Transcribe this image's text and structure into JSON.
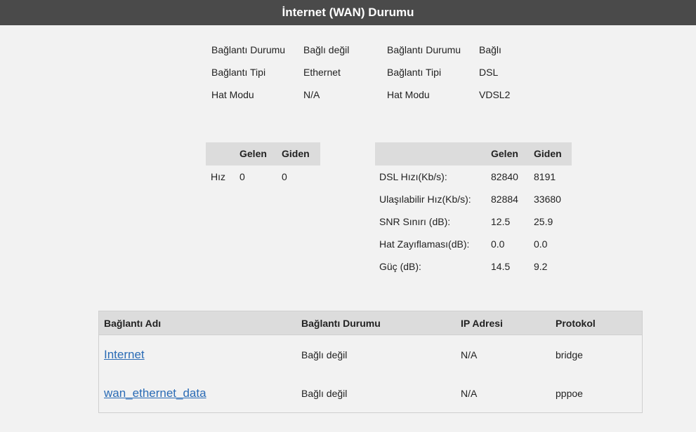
{
  "header": {
    "title": "İnternet (WAN) Durumu"
  },
  "status_left": {
    "rows": [
      {
        "label": "Bağlantı Durumu",
        "value": "Bağlı değil"
      },
      {
        "label": "Bağlantı Tipi",
        "value": "Ethernet"
      },
      {
        "label": "Hat Modu",
        "value": "N/A"
      }
    ]
  },
  "status_right": {
    "rows": [
      {
        "label": "Bağlantı Durumu",
        "value": "Bağlı"
      },
      {
        "label": "Bağlantı Tipi",
        "value": "DSL"
      },
      {
        "label": "Hat Modu",
        "value": "VDSL2"
      }
    ]
  },
  "speed_table": {
    "headers": [
      "Gelen",
      "Giden"
    ],
    "row": {
      "label": "Hız",
      "in": "0",
      "out": "0"
    }
  },
  "dsl_table": {
    "headers": [
      "Gelen",
      "Giden"
    ],
    "rows": [
      {
        "label": "DSL Hızı(Kb/s):",
        "in": "82840",
        "out": "8191"
      },
      {
        "label": "Ulaşılabilir Hız(Kb/s):",
        "in": "82884",
        "out": "33680"
      },
      {
        "label": "SNR Sınırı (dB):",
        "in": "12.5",
        "out": "25.9"
      },
      {
        "label": "Hat Zayıflaması(dB):",
        "in": "0.0",
        "out": "0.0"
      },
      {
        "label": "Güç (dB):",
        "in": "14.5",
        "out": "9.2"
      }
    ]
  },
  "connections": {
    "headers": [
      "Bağlantı Adı",
      "Bağlantı Durumu",
      "IP Adresi",
      "Protokol"
    ],
    "rows": [
      {
        "name": "Internet",
        "status": "Bağlı değil",
        "ip": "N/A",
        "protocol": "bridge"
      },
      {
        "name": "wan_ethernet_data",
        "status": "Bağlı değil",
        "ip": "N/A",
        "protocol": "pppoe"
      }
    ]
  }
}
